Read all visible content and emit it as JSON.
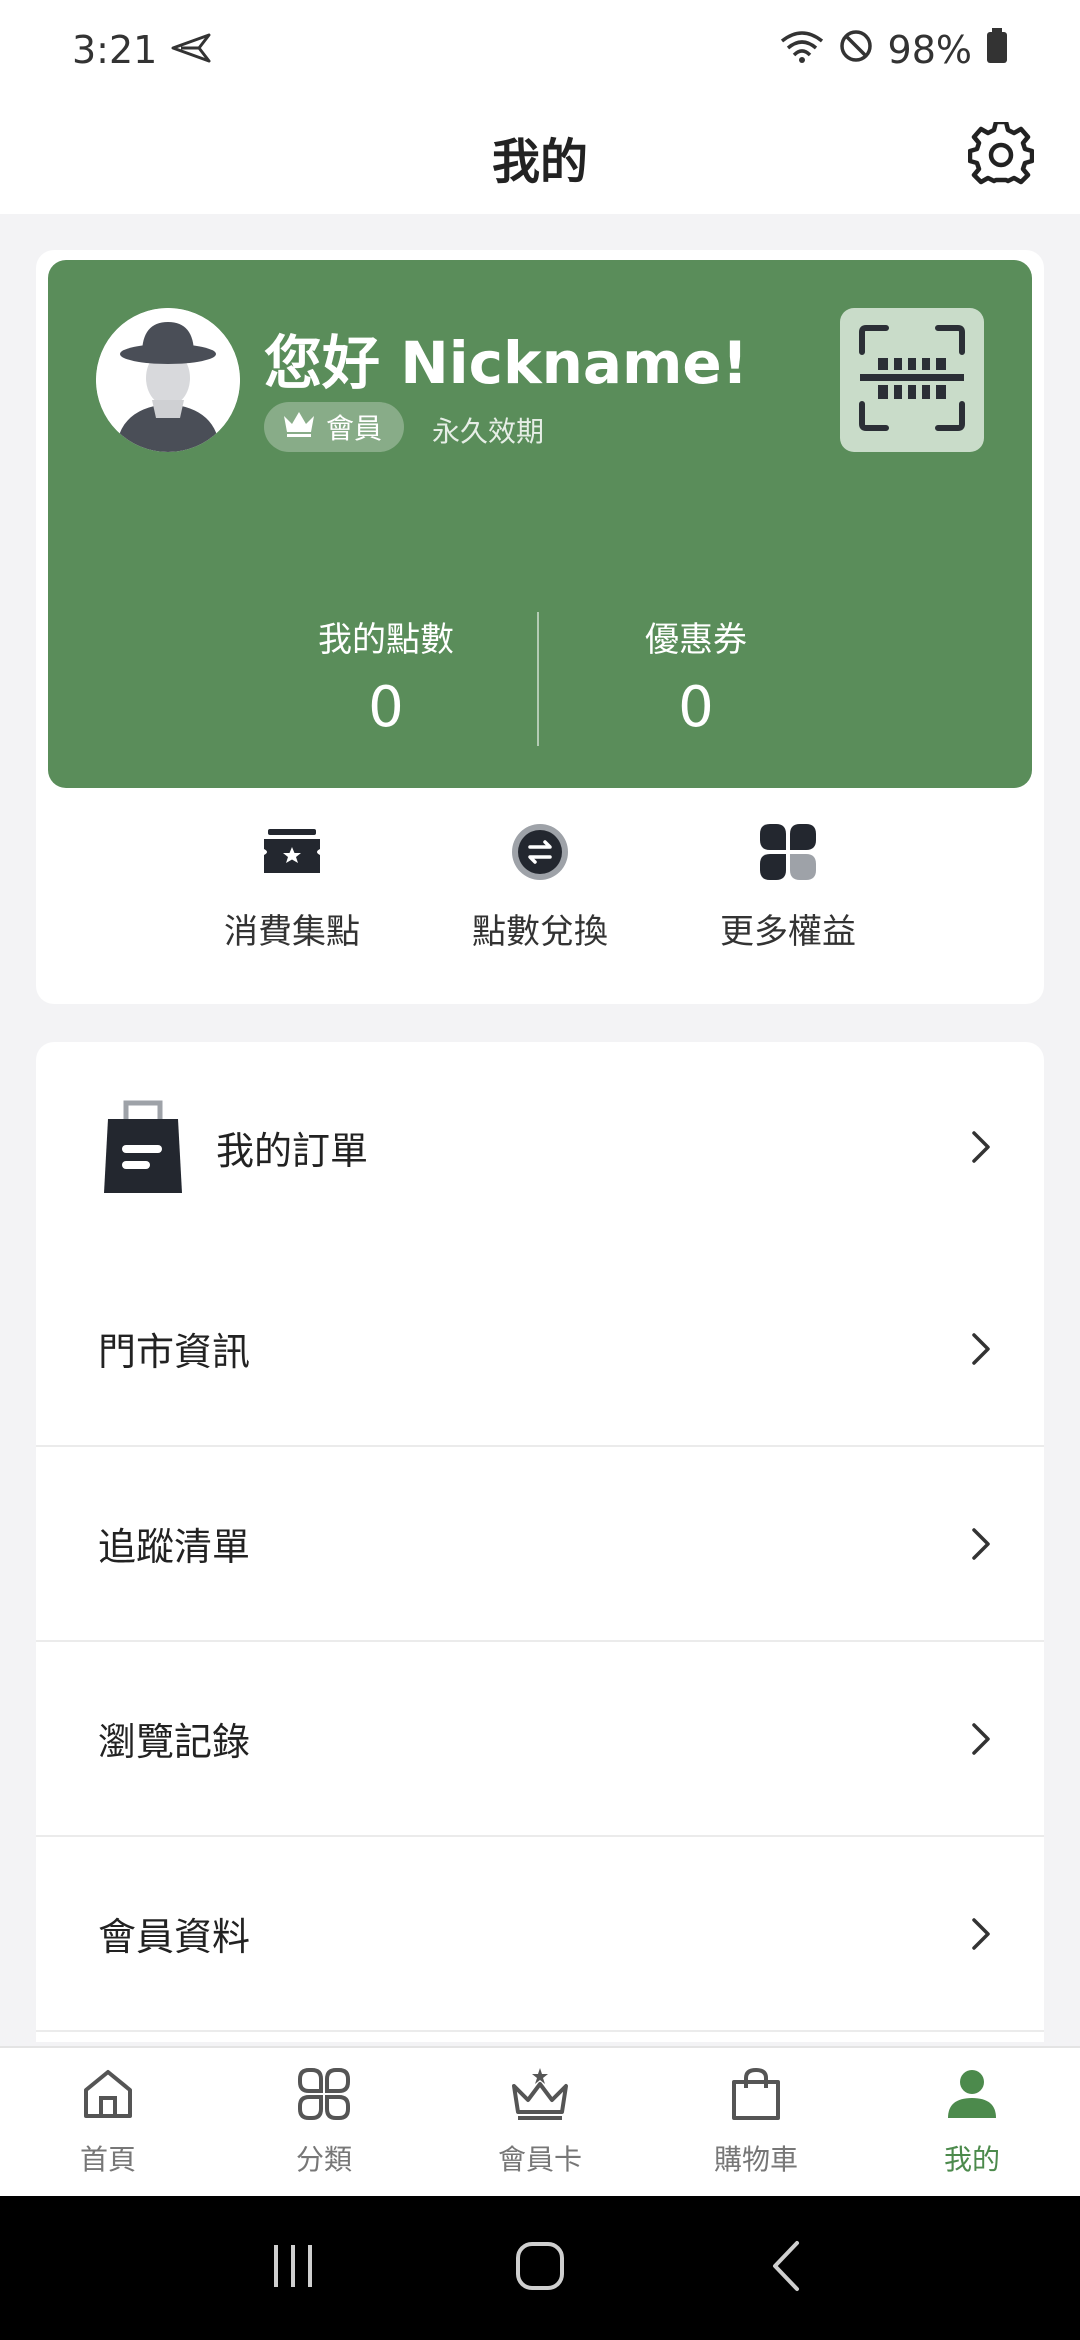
{
  "status_bar": {
    "time": "3:21",
    "battery": "98%"
  },
  "header": {
    "title": "我的"
  },
  "member_card": {
    "greeting": "您好 Nickname!",
    "badge_label": "會員",
    "validity": "永久效期",
    "points_label": "我的點數",
    "points_value": "0",
    "coupons_label": "優惠券",
    "coupons_value": "0",
    "accent_color": "#5a8d5a"
  },
  "quick_actions": [
    {
      "label": "消費集點",
      "icon": "ticket-star-icon"
    },
    {
      "label": "點數兌換",
      "icon": "exchange-icon"
    },
    {
      "label": "更多權益",
      "icon": "grid-benefits-icon"
    }
  ],
  "menu": [
    {
      "label": "我的訂單",
      "icon": "shopping-bag-icon"
    },
    {
      "label": "門市資訊"
    },
    {
      "label": "追蹤清單"
    },
    {
      "label": "瀏覽記錄"
    },
    {
      "label": "會員資料"
    }
  ],
  "bottom_nav": [
    {
      "label": "首頁",
      "icon": "home-icon"
    },
    {
      "label": "分類",
      "icon": "category-icon"
    },
    {
      "label": "會員卡",
      "icon": "crown-icon"
    },
    {
      "label": "購物車",
      "icon": "bag-icon"
    },
    {
      "label": "我的",
      "icon": "person-icon",
      "active": true
    }
  ],
  "colors": {
    "active_nav": "#4c8a4c",
    "card_green": "#5a8d5a"
  }
}
